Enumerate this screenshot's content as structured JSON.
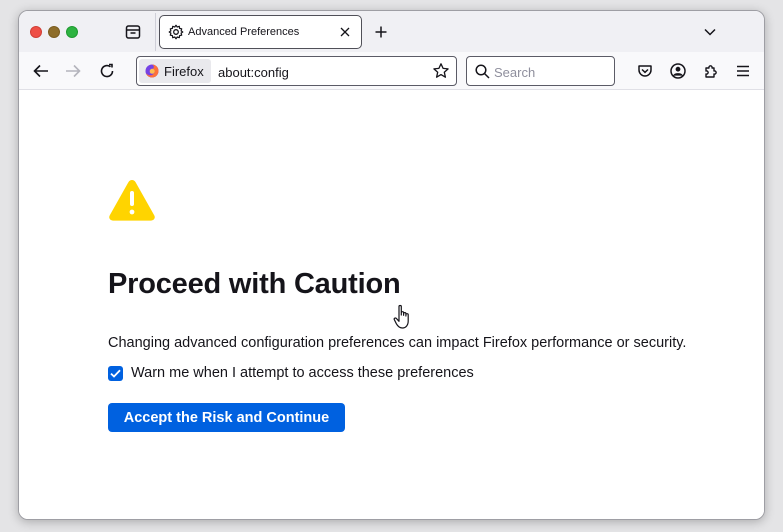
{
  "tab": {
    "title": "Advanced Preferences"
  },
  "urlbar": {
    "identity_label": "Firefox",
    "url": "about:config"
  },
  "search": {
    "placeholder": "Search"
  },
  "page": {
    "heading": "Proceed with Caution",
    "description": "Changing advanced configuration preferences can impact Firefox performance or security.",
    "checkbox_label": "Warn me when I attempt to access these preferences",
    "checkbox_checked": true,
    "accept_label": "Accept the Risk and Continue"
  },
  "colors": {
    "accent": "#0061e0",
    "warning": "#ffd400",
    "text": "#15141a"
  },
  "icons": [
    "tab-overview-icon",
    "gear-icon",
    "close-icon",
    "plus-icon",
    "chevron-down-icon",
    "back-arrow-icon",
    "forward-arrow-icon",
    "reload-icon",
    "firefox-logo-icon",
    "star-icon",
    "search-icon",
    "pocket-icon",
    "account-icon",
    "extensions-icon",
    "hamburger-menu-icon",
    "warning-icon",
    "checkmark-icon",
    "hand-cursor-icon"
  ]
}
